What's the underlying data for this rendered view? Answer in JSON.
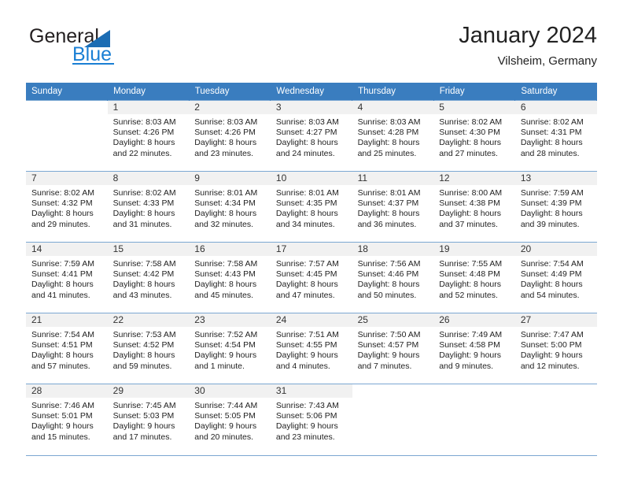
{
  "brand": {
    "word_one": "General",
    "word_two": "Blue",
    "logo_icon": "triangle-logo-icon",
    "accent_color": "#1a7fd4",
    "triangle_color": "#1b6cb3"
  },
  "header": {
    "title": "January 2024",
    "subtitle": "Vilsheim, Germany"
  },
  "theme": {
    "header_row_color": "#3a7dbf",
    "grid_line_color": "#7ba7d2",
    "daynum_bar_color": "#f1f1f1"
  },
  "weekday_headers": [
    "Sunday",
    "Monday",
    "Tuesday",
    "Wednesday",
    "Thursday",
    "Friday",
    "Saturday"
  ],
  "weeks": [
    [
      {
        "day": "",
        "sunrise": "",
        "sunset": "",
        "daylight_1": "",
        "daylight_2": "",
        "blank": true
      },
      {
        "day": "1",
        "sunrise": "Sunrise: 8:03 AM",
        "sunset": "Sunset: 4:26 PM",
        "daylight_1": "Daylight: 8 hours",
        "daylight_2": "and 22 minutes."
      },
      {
        "day": "2",
        "sunrise": "Sunrise: 8:03 AM",
        "sunset": "Sunset: 4:26 PM",
        "daylight_1": "Daylight: 8 hours",
        "daylight_2": "and 23 minutes."
      },
      {
        "day": "3",
        "sunrise": "Sunrise: 8:03 AM",
        "sunset": "Sunset: 4:27 PM",
        "daylight_1": "Daylight: 8 hours",
        "daylight_2": "and 24 minutes."
      },
      {
        "day": "4",
        "sunrise": "Sunrise: 8:03 AM",
        "sunset": "Sunset: 4:28 PM",
        "daylight_1": "Daylight: 8 hours",
        "daylight_2": "and 25 minutes."
      },
      {
        "day": "5",
        "sunrise": "Sunrise: 8:02 AM",
        "sunset": "Sunset: 4:30 PM",
        "daylight_1": "Daylight: 8 hours",
        "daylight_2": "and 27 minutes."
      },
      {
        "day": "6",
        "sunrise": "Sunrise: 8:02 AM",
        "sunset": "Sunset: 4:31 PM",
        "daylight_1": "Daylight: 8 hours",
        "daylight_2": "and 28 minutes."
      }
    ],
    [
      {
        "day": "7",
        "sunrise": "Sunrise: 8:02 AM",
        "sunset": "Sunset: 4:32 PM",
        "daylight_1": "Daylight: 8 hours",
        "daylight_2": "and 29 minutes."
      },
      {
        "day": "8",
        "sunrise": "Sunrise: 8:02 AM",
        "sunset": "Sunset: 4:33 PM",
        "daylight_1": "Daylight: 8 hours",
        "daylight_2": "and 31 minutes."
      },
      {
        "day": "9",
        "sunrise": "Sunrise: 8:01 AM",
        "sunset": "Sunset: 4:34 PM",
        "daylight_1": "Daylight: 8 hours",
        "daylight_2": "and 32 minutes."
      },
      {
        "day": "10",
        "sunrise": "Sunrise: 8:01 AM",
        "sunset": "Sunset: 4:35 PM",
        "daylight_1": "Daylight: 8 hours",
        "daylight_2": "and 34 minutes."
      },
      {
        "day": "11",
        "sunrise": "Sunrise: 8:01 AM",
        "sunset": "Sunset: 4:37 PM",
        "daylight_1": "Daylight: 8 hours",
        "daylight_2": "and 36 minutes."
      },
      {
        "day": "12",
        "sunrise": "Sunrise: 8:00 AM",
        "sunset": "Sunset: 4:38 PM",
        "daylight_1": "Daylight: 8 hours",
        "daylight_2": "and 37 minutes."
      },
      {
        "day": "13",
        "sunrise": "Sunrise: 7:59 AM",
        "sunset": "Sunset: 4:39 PM",
        "daylight_1": "Daylight: 8 hours",
        "daylight_2": "and 39 minutes."
      }
    ],
    [
      {
        "day": "14",
        "sunrise": "Sunrise: 7:59 AM",
        "sunset": "Sunset: 4:41 PM",
        "daylight_1": "Daylight: 8 hours",
        "daylight_2": "and 41 minutes."
      },
      {
        "day": "15",
        "sunrise": "Sunrise: 7:58 AM",
        "sunset": "Sunset: 4:42 PM",
        "daylight_1": "Daylight: 8 hours",
        "daylight_2": "and 43 minutes."
      },
      {
        "day": "16",
        "sunrise": "Sunrise: 7:58 AM",
        "sunset": "Sunset: 4:43 PM",
        "daylight_1": "Daylight: 8 hours",
        "daylight_2": "and 45 minutes."
      },
      {
        "day": "17",
        "sunrise": "Sunrise: 7:57 AM",
        "sunset": "Sunset: 4:45 PM",
        "daylight_1": "Daylight: 8 hours",
        "daylight_2": "and 47 minutes."
      },
      {
        "day": "18",
        "sunrise": "Sunrise: 7:56 AM",
        "sunset": "Sunset: 4:46 PM",
        "daylight_1": "Daylight: 8 hours",
        "daylight_2": "and 50 minutes."
      },
      {
        "day": "19",
        "sunrise": "Sunrise: 7:55 AM",
        "sunset": "Sunset: 4:48 PM",
        "daylight_1": "Daylight: 8 hours",
        "daylight_2": "and 52 minutes."
      },
      {
        "day": "20",
        "sunrise": "Sunrise: 7:54 AM",
        "sunset": "Sunset: 4:49 PM",
        "daylight_1": "Daylight: 8 hours",
        "daylight_2": "and 54 minutes."
      }
    ],
    [
      {
        "day": "21",
        "sunrise": "Sunrise: 7:54 AM",
        "sunset": "Sunset: 4:51 PM",
        "daylight_1": "Daylight: 8 hours",
        "daylight_2": "and 57 minutes."
      },
      {
        "day": "22",
        "sunrise": "Sunrise: 7:53 AM",
        "sunset": "Sunset: 4:52 PM",
        "daylight_1": "Daylight: 8 hours",
        "daylight_2": "and 59 minutes."
      },
      {
        "day": "23",
        "sunrise": "Sunrise: 7:52 AM",
        "sunset": "Sunset: 4:54 PM",
        "daylight_1": "Daylight: 9 hours",
        "daylight_2": "and 1 minute."
      },
      {
        "day": "24",
        "sunrise": "Sunrise: 7:51 AM",
        "sunset": "Sunset: 4:55 PM",
        "daylight_1": "Daylight: 9 hours",
        "daylight_2": "and 4 minutes."
      },
      {
        "day": "25",
        "sunrise": "Sunrise: 7:50 AM",
        "sunset": "Sunset: 4:57 PM",
        "daylight_1": "Daylight: 9 hours",
        "daylight_2": "and 7 minutes."
      },
      {
        "day": "26",
        "sunrise": "Sunrise: 7:49 AM",
        "sunset": "Sunset: 4:58 PM",
        "daylight_1": "Daylight: 9 hours",
        "daylight_2": "and 9 minutes."
      },
      {
        "day": "27",
        "sunrise": "Sunrise: 7:47 AM",
        "sunset": "Sunset: 5:00 PM",
        "daylight_1": "Daylight: 9 hours",
        "daylight_2": "and 12 minutes."
      }
    ],
    [
      {
        "day": "28",
        "sunrise": "Sunrise: 7:46 AM",
        "sunset": "Sunset: 5:01 PM",
        "daylight_1": "Daylight: 9 hours",
        "daylight_2": "and 15 minutes."
      },
      {
        "day": "29",
        "sunrise": "Sunrise: 7:45 AM",
        "sunset": "Sunset: 5:03 PM",
        "daylight_1": "Daylight: 9 hours",
        "daylight_2": "and 17 minutes."
      },
      {
        "day": "30",
        "sunrise": "Sunrise: 7:44 AM",
        "sunset": "Sunset: 5:05 PM",
        "daylight_1": "Daylight: 9 hours",
        "daylight_2": "and 20 minutes."
      },
      {
        "day": "31",
        "sunrise": "Sunrise: 7:43 AM",
        "sunset": "Sunset: 5:06 PM",
        "daylight_1": "Daylight: 9 hours",
        "daylight_2": "and 23 minutes."
      },
      {
        "day": "",
        "sunrise": "",
        "sunset": "",
        "daylight_1": "",
        "daylight_2": "",
        "blank": true
      },
      {
        "day": "",
        "sunrise": "",
        "sunset": "",
        "daylight_1": "",
        "daylight_2": "",
        "blank": true
      },
      {
        "day": "",
        "sunrise": "",
        "sunset": "",
        "daylight_1": "",
        "daylight_2": "",
        "blank": true
      }
    ]
  ]
}
